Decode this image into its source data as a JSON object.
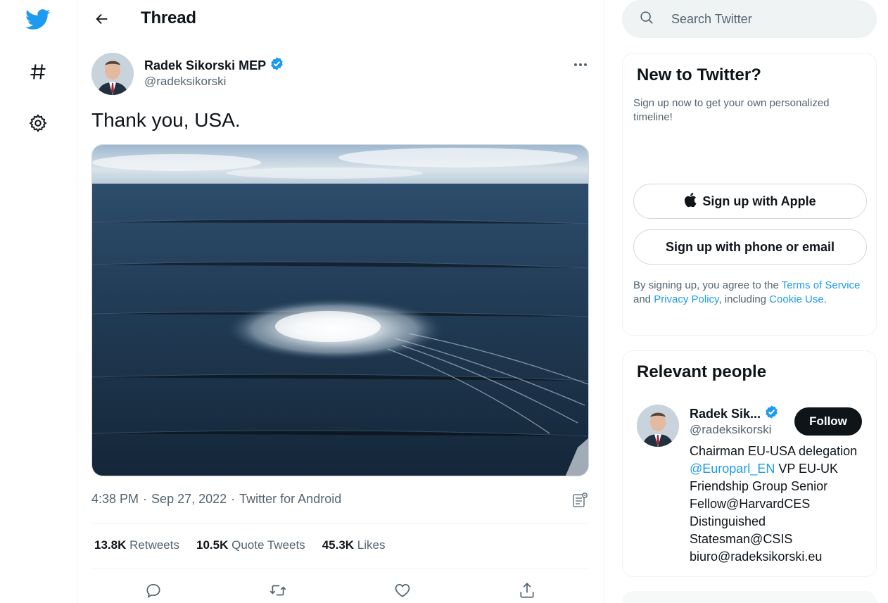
{
  "header": {
    "title": "Thread"
  },
  "tweet": {
    "author_name": "Radek Sikorski MEP",
    "author_handle": "@radeksikorski",
    "text": "Thank you, USA.",
    "time": "4:38 PM",
    "separator": "·",
    "date": "Sep 27, 2022",
    "source": "Twitter for Android",
    "stats": {
      "retweets_count": "13.8K",
      "retweets_label": "Retweets",
      "quotes_count": "10.5K",
      "quotes_label": "Quote Tweets",
      "likes_count": "45.3K",
      "likes_label": "Likes"
    }
  },
  "search": {
    "placeholder": "Search Twitter"
  },
  "signup_card": {
    "title": "New to Twitter?",
    "subtitle": "Sign up now to get your own personalized timeline!",
    "apple_label": "Sign up with Apple",
    "phone_label": "Sign up with phone or email",
    "legal_prefix": "By signing up, you agree to the ",
    "terms": "Terms of Service",
    "and": " and ",
    "privacy": "Privacy Policy",
    "including": ", including ",
    "cookie": "Cookie Use",
    "end": "."
  },
  "people_card": {
    "title": "Relevant people",
    "name": "Radek Sik...",
    "handle": "@radeksikorski",
    "follow_label": "Follow",
    "bio_1": "Chairman EU-USA delegation ",
    "bio_link": "@Europarl_EN",
    "bio_2": " VP EU-UK Friendship Group Senior Fellow@HarvardCES Distinguished Statesman@CSIS biuro@radeksikorski.eu"
  },
  "colors": {
    "accent": "#1d9bf0",
    "text": "#0f1419",
    "secondary": "#536471",
    "follow_bg": "#0f1419"
  }
}
